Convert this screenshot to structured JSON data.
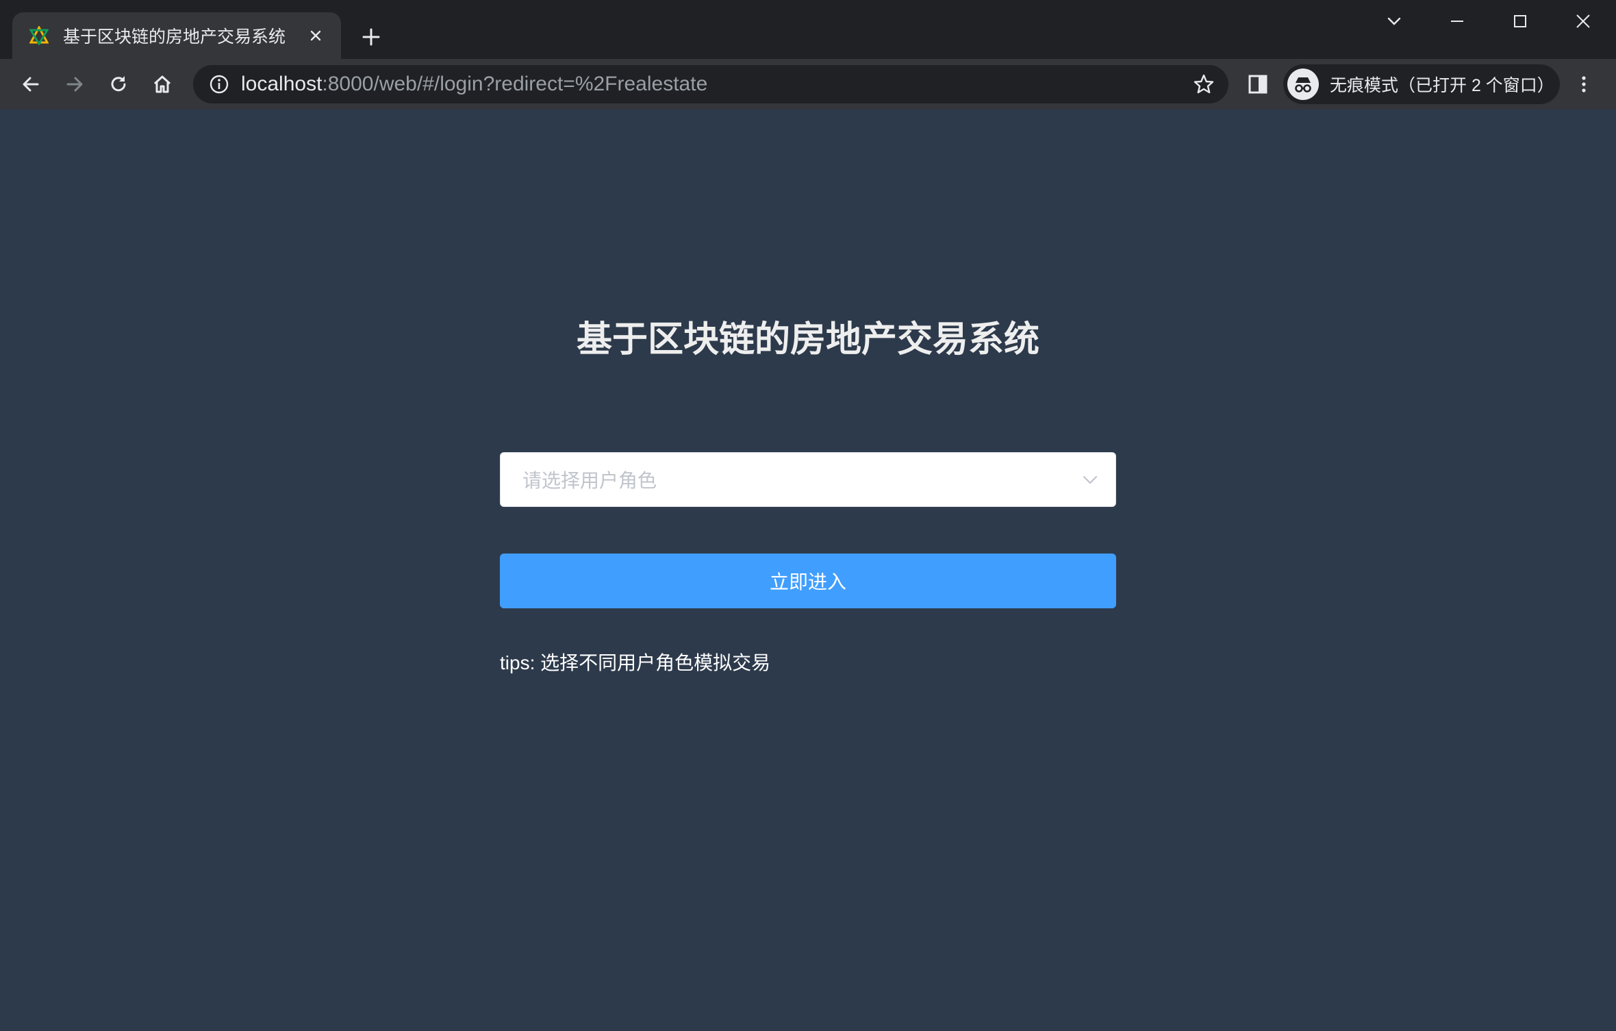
{
  "browser": {
    "tab": {
      "title": "基于区块链的房地产交易系统"
    },
    "address_bar": {
      "host": "localhost",
      "path": ":8000/web/#/login?redirect=%2Frealestate"
    },
    "incognito_label": "无痕模式（已打开 2 个窗口）",
    "icons": {
      "favicon": "app-favicon-icon",
      "tab_close": "close-icon",
      "new_tab": "plus-icon",
      "tab_search": "chevron-down-icon",
      "minimize": "minimize-icon",
      "maximize": "maximize-icon",
      "close_window": "close-icon",
      "back": "arrow-left-icon",
      "forward": "arrow-right-icon",
      "reload": "reload-icon",
      "home": "home-icon",
      "site_info": "info-icon",
      "bookmark": "star-icon",
      "side_panel": "side-panel-icon",
      "incognito": "incognito-icon",
      "menu": "kebab-menu-icon"
    }
  },
  "login": {
    "title": "基于区块链的房地产交易系统",
    "role_select": {
      "placeholder": "请选择用户角色",
      "selected": ""
    },
    "submit_label": "立即进入",
    "tips": "tips: 选择不同用户角色模拟交易"
  },
  "colors": {
    "page_background": "#2d3a4b",
    "primary_button": "#409eff",
    "placeholder_text": "#c0c4cc",
    "title_text": "#eeeeee"
  }
}
